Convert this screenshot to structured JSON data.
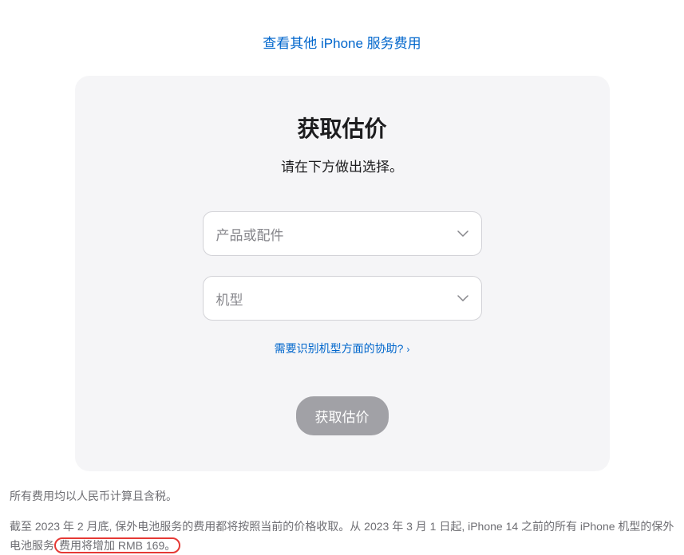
{
  "topLink": {
    "label": "查看其他 iPhone 服务费用"
  },
  "card": {
    "title": "获取估价",
    "subtitle": "请在下方做出选择。",
    "select1": {
      "placeholder": "产品或配件"
    },
    "select2": {
      "placeholder": "机型"
    },
    "helpLink": {
      "label": "需要识别机型方面的协助?",
      "arrow": "›"
    },
    "submitLabel": "获取估价"
  },
  "footer": {
    "line1": "所有费用均以人民币计算且含税。",
    "line2_part1": "截至 2023 年 2 月底, 保外电池服务的费用都将按照当前的价格收取。从 2023 年 3 月 1 日起, iPhone 14 之前的所有 iPhone 机型的保外电池服务",
    "line2_highlight": "费用将增加 RMB 169。"
  }
}
